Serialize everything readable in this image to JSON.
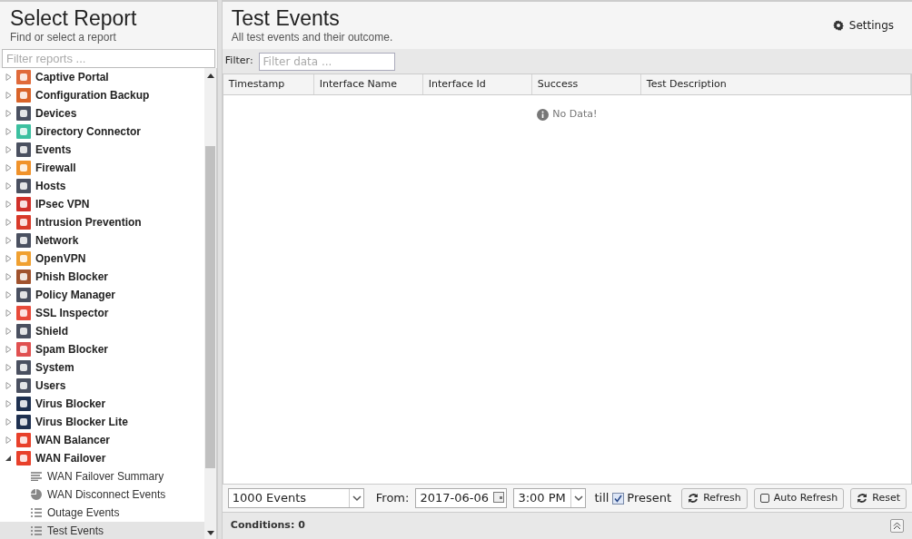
{
  "left_panel": {
    "title": "Select Report",
    "subtitle": "Find or select a report",
    "filter": {
      "placeholder": "Filter reports ..."
    },
    "tree": [
      {
        "label": "Captive Portal",
        "color": "#e06a3a",
        "expanded": false
      },
      {
        "label": "Configuration Backup",
        "color": "#d9642a",
        "expanded": false
      },
      {
        "label": "Devices",
        "color": "#4a5060",
        "expanded": false
      },
      {
        "label": "Directory Connector",
        "color": "#3cc0a0",
        "expanded": false
      },
      {
        "label": "Events",
        "color": "#4a5060",
        "expanded": false
      },
      {
        "label": "Firewall",
        "color": "#f0922a",
        "expanded": false
      },
      {
        "label": "Hosts",
        "color": "#4a5060",
        "expanded": false
      },
      {
        "label": "IPsec VPN",
        "color": "#d0302a",
        "expanded": false
      },
      {
        "label": "Intrusion Prevention",
        "color": "#d83a2a",
        "expanded": false
      },
      {
        "label": "Network",
        "color": "#4a5060",
        "expanded": false
      },
      {
        "label": "OpenVPN",
        "color": "#f0a030",
        "expanded": false
      },
      {
        "label": "Phish Blocker",
        "color": "#a0522d",
        "expanded": false
      },
      {
        "label": "Policy Manager",
        "color": "#4a5060",
        "expanded": false
      },
      {
        "label": "SSL Inspector",
        "color": "#e84a3a",
        "expanded": false
      },
      {
        "label": "Shield",
        "color": "#4a5060",
        "expanded": false
      },
      {
        "label": "Spam Blocker",
        "color": "#e05050",
        "expanded": false
      },
      {
        "label": "System",
        "color": "#4a5060",
        "expanded": false
      },
      {
        "label": "Users",
        "color": "#4a5060",
        "expanded": false
      },
      {
        "label": "Virus Blocker",
        "color": "#1e3050",
        "expanded": false
      },
      {
        "label": "Virus Blocker Lite",
        "color": "#1e3050",
        "expanded": false
      },
      {
        "label": "WAN Balancer",
        "color": "#e8402a",
        "expanded": false
      },
      {
        "label": "WAN Failover",
        "color": "#e8402a",
        "expanded": true,
        "children": [
          {
            "label": "WAN Failover Summary",
            "kind": "summary",
            "selected": false
          },
          {
            "label": "WAN Disconnect Events",
            "kind": "pie",
            "selected": false
          },
          {
            "label": "Outage Events",
            "kind": "list",
            "selected": false
          },
          {
            "label": "Test Events",
            "kind": "list",
            "selected": true
          }
        ]
      }
    ]
  },
  "report": {
    "title": "Test Events",
    "subtitle": "All test events and their outcome.",
    "settings": "Settings",
    "filter": {
      "label": "Filter:",
      "placeholder": "Filter data ..."
    },
    "table": {
      "columns": [
        "Timestamp",
        "Interface Name",
        "Interface Id",
        "Success",
        "Test Description"
      ],
      "empty_message": "No Data!"
    },
    "toolbar": {
      "limit": "1000 Events",
      "from_label": "From:",
      "date": "2017-06-06",
      "time": "3:00 PM",
      "till_label": "till",
      "present": {
        "label": "Present",
        "checked": true
      },
      "refresh": "Refresh",
      "auto_refresh": {
        "label": "Auto Refresh",
        "checked": false
      },
      "reset": "Reset"
    },
    "conditions": "Conditions: 0"
  }
}
